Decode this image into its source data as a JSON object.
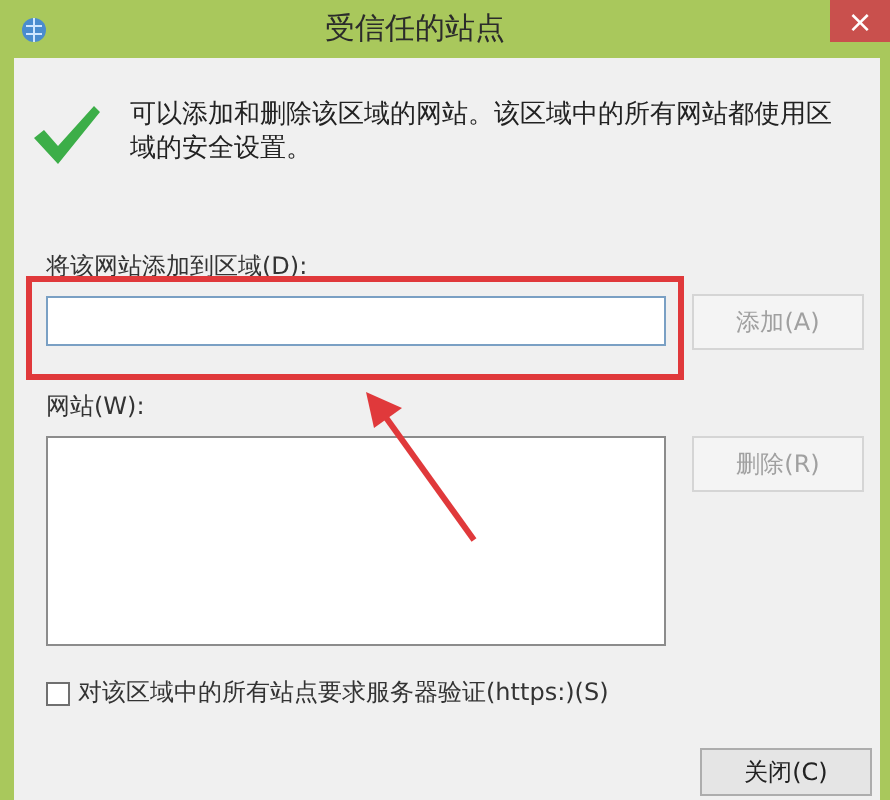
{
  "window": {
    "title": "受信任的站点",
    "close": "×"
  },
  "message": "可以添加和删除该区域的网站。该区域中的所有网站都使用区域的安全设置。",
  "add_site": {
    "label": "将该网站添加到区域(D):",
    "button": "添加(A)",
    "button_disabled": true
  },
  "sites": {
    "label": "网站(W):",
    "button": "删除(R)",
    "button_disabled": true
  },
  "require_https": {
    "label": "对该区域中的所有站点要求服务器验证(https:)(S)",
    "checked": false
  },
  "buttons": [
    "关闭(C)"
  ]
}
